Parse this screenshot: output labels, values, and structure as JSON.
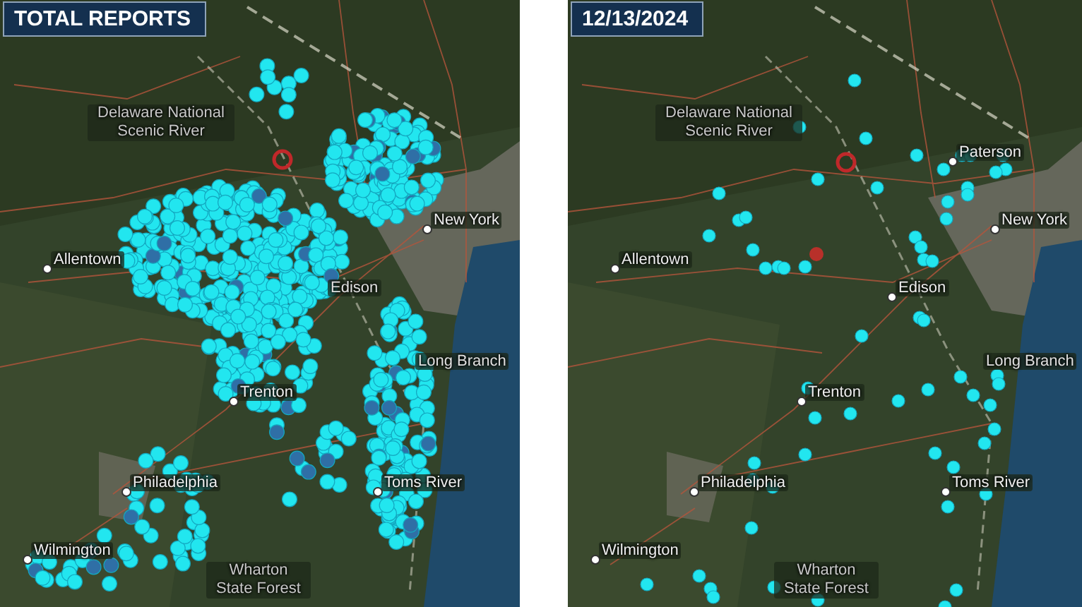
{
  "panels": [
    {
      "title": "TOTAL REPORTS",
      "kind": "cumulative",
      "labels": [
        {
          "text": "Delaware National Scenic River",
          "kind": "region"
        },
        {
          "text": "Allentown",
          "kind": "city"
        },
        {
          "text": "New York",
          "kind": "city"
        },
        {
          "text": "Edison",
          "kind": "town"
        },
        {
          "text": "Long Branch",
          "kind": "town"
        },
        {
          "text": "Trenton",
          "kind": "city"
        },
        {
          "text": "Philadelphia",
          "kind": "city"
        },
        {
          "text": "Toms River",
          "kind": "city"
        },
        {
          "text": "Wilmington",
          "kind": "city"
        },
        {
          "text": "Wharton State Forest",
          "kind": "region"
        }
      ]
    },
    {
      "title": "12/13/2024",
      "kind": "daily",
      "labels": [
        {
          "text": "Delaware National Scenic River",
          "kind": "region"
        },
        {
          "text": "Allentown",
          "kind": "city"
        },
        {
          "text": "New York",
          "kind": "city"
        },
        {
          "text": "Edison",
          "kind": "city"
        },
        {
          "text": "Long Branch",
          "kind": "town"
        },
        {
          "text": "Trenton",
          "kind": "city"
        },
        {
          "text": "Philadelphia",
          "kind": "city"
        },
        {
          "text": "Toms River",
          "kind": "city"
        },
        {
          "text": "Wilmington",
          "kind": "city"
        },
        {
          "text": "Wharton State Forest",
          "kind": "region"
        },
        {
          "text": "Paterson",
          "kind": "city"
        }
      ]
    }
  ]
}
